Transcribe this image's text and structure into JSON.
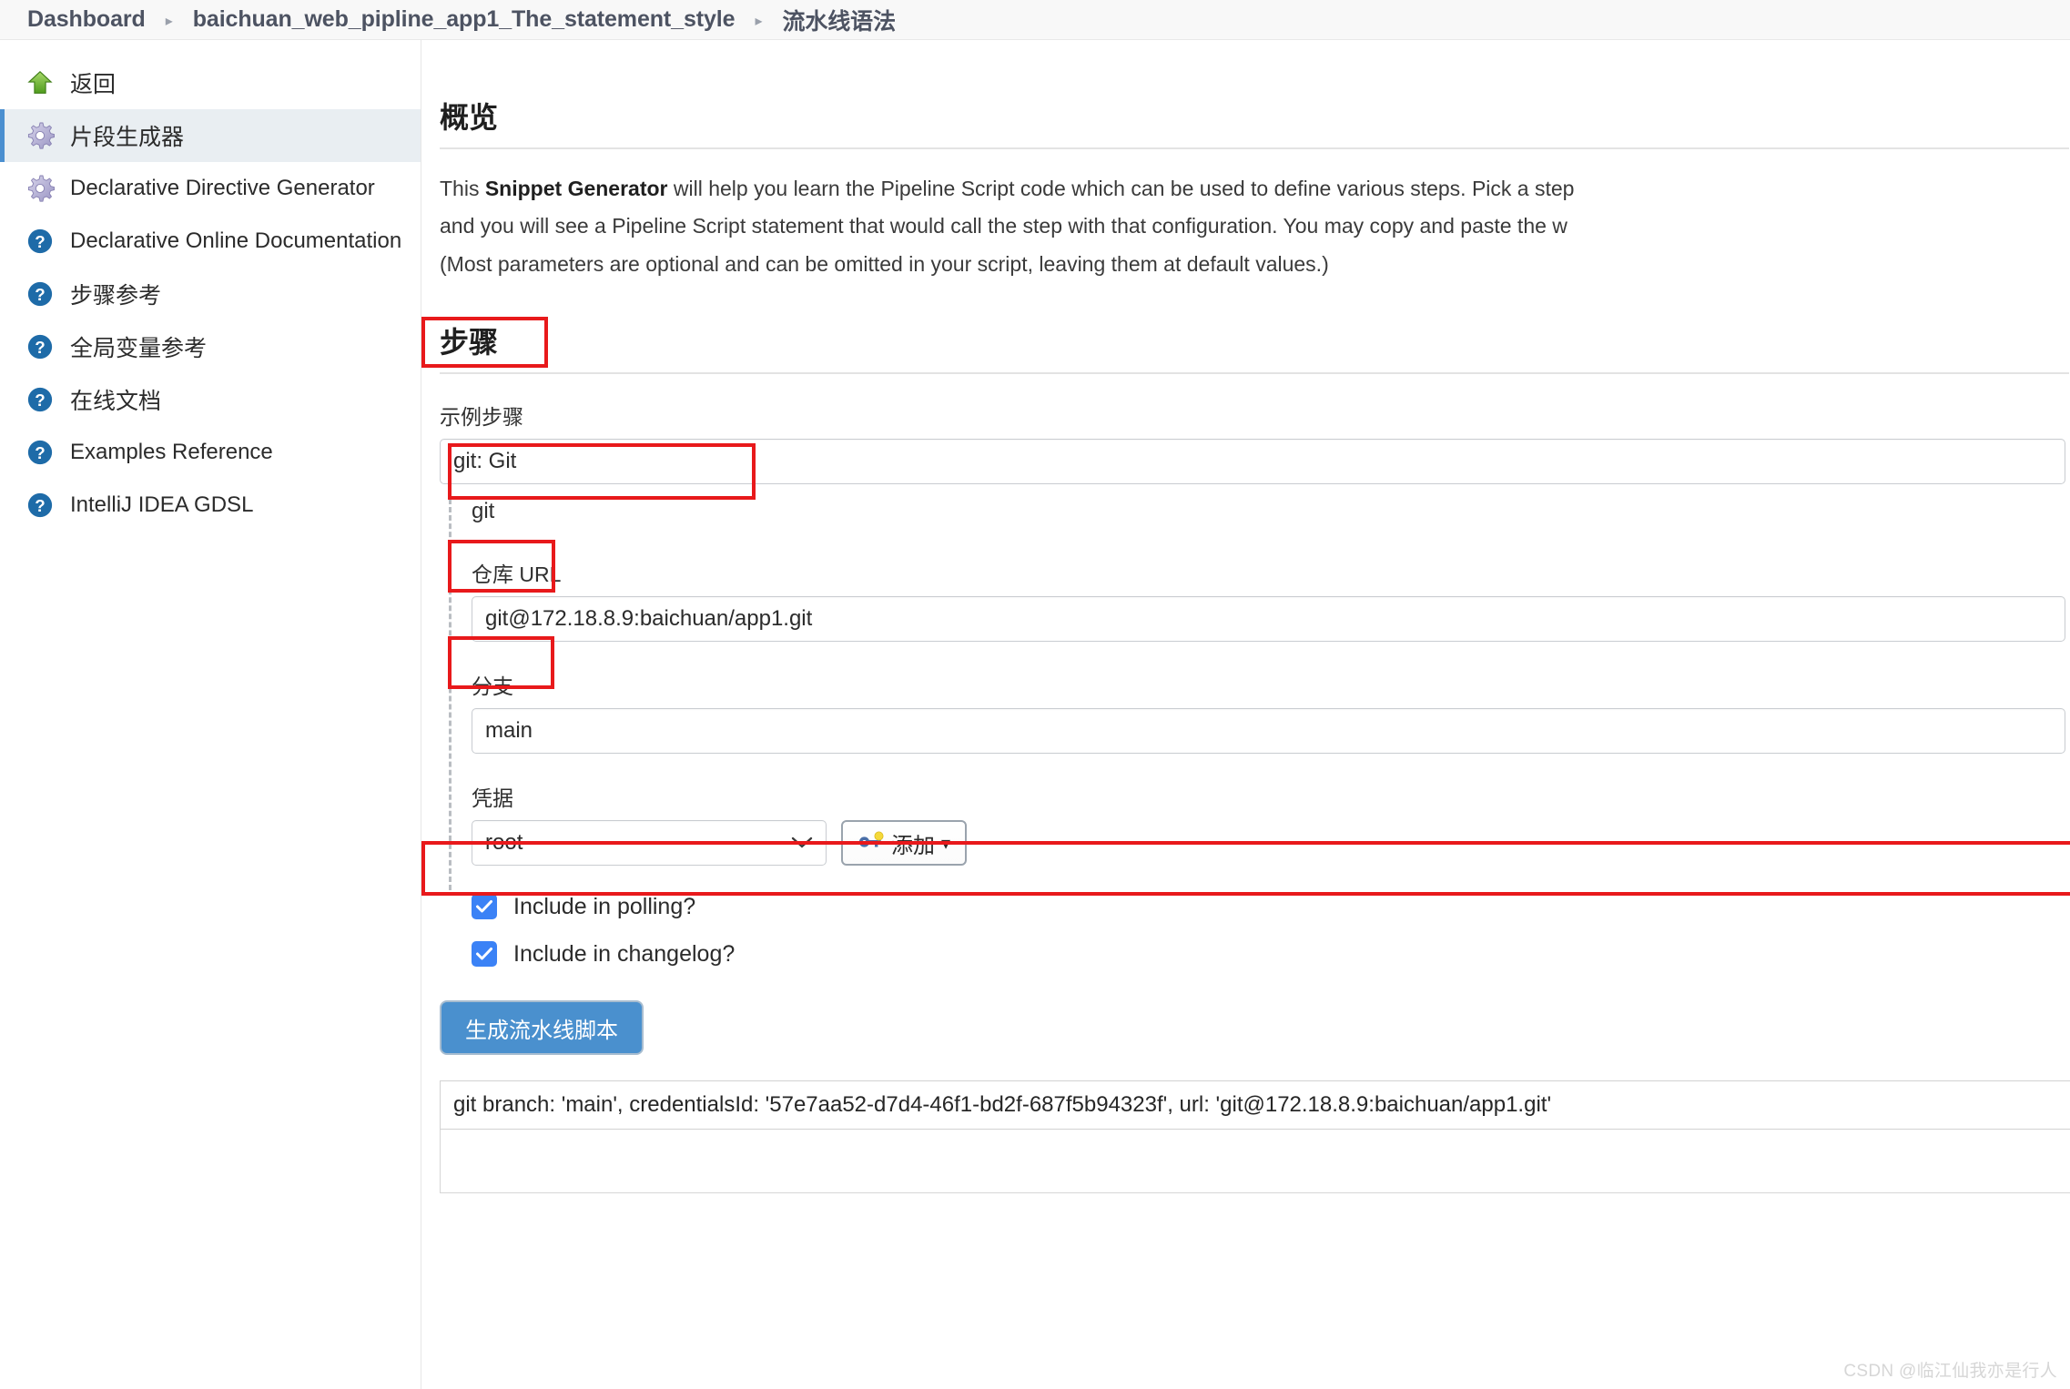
{
  "breadcrumb": {
    "items": [
      {
        "label": "Dashboard"
      },
      {
        "label": "baichuan_web_pipline_app1_The_statement_style"
      },
      {
        "label": "流水线语法"
      }
    ],
    "separator": "▸"
  },
  "sidebar": {
    "items": [
      {
        "label": "返回",
        "icon": "up-arrow-icon",
        "active": false
      },
      {
        "label": "片段生成器",
        "icon": "gear-icon",
        "active": true
      },
      {
        "label": "Declarative Directive Generator",
        "icon": "gear-icon",
        "active": false
      },
      {
        "label": "Declarative Online Documentation",
        "icon": "help-icon",
        "active": false
      },
      {
        "label": "步骤参考",
        "icon": "help-icon",
        "active": false
      },
      {
        "label": "全局变量参考",
        "icon": "help-icon",
        "active": false
      },
      {
        "label": "在线文档",
        "icon": "help-icon",
        "active": false
      },
      {
        "label": "Examples Reference",
        "icon": "help-icon",
        "active": false
      },
      {
        "label": "IntelliJ IDEA GDSL",
        "icon": "help-icon",
        "active": false
      }
    ]
  },
  "overview": {
    "heading": "概览",
    "line1_prefix": "This ",
    "line1_bold": "Snippet Generator",
    "line1_suffix": " will help you learn the Pipeline Script code which can be used to define various steps. Pick a step",
    "line2": "and you will see a Pipeline Script statement that would call the step with that configuration. You may copy and paste the w",
    "line3": "(Most parameters are optional and can be omitted in your script, leaving them at default values.)"
  },
  "steps": {
    "heading": "步骤",
    "sample_step_label": "示例步骤",
    "sample_step_value": "git: Git",
    "step_name": "git",
    "repo_url_label": "仓库 URL",
    "repo_url_value": "git@172.18.8.9:baichuan/app1.git",
    "branch_label": "分支",
    "branch_value": "main",
    "credentials_label": "凭据",
    "credentials_value": "root",
    "add_button_label": "添加",
    "add_button_caret": "▾",
    "checkbox_polling": "Include in polling?",
    "checkbox_changelog": "Include in changelog?",
    "generate_button_label": "生成流水线脚本",
    "generated_code": "git branch: 'main', credentialsId: '57e7aa52-d7d4-46f1-bd2f-687f5b94323f', url: 'git@172.18.8.9:baichuan/app1.git'"
  },
  "watermark": {
    "text": "CSDN @临江仙我亦是行人"
  },
  "colors": {
    "accent_blue": "#4a90ce",
    "highlight_red": "#e8191b",
    "active_sidebar_bg": "#e9eef2",
    "checkbox_blue": "#3b82f6"
  }
}
